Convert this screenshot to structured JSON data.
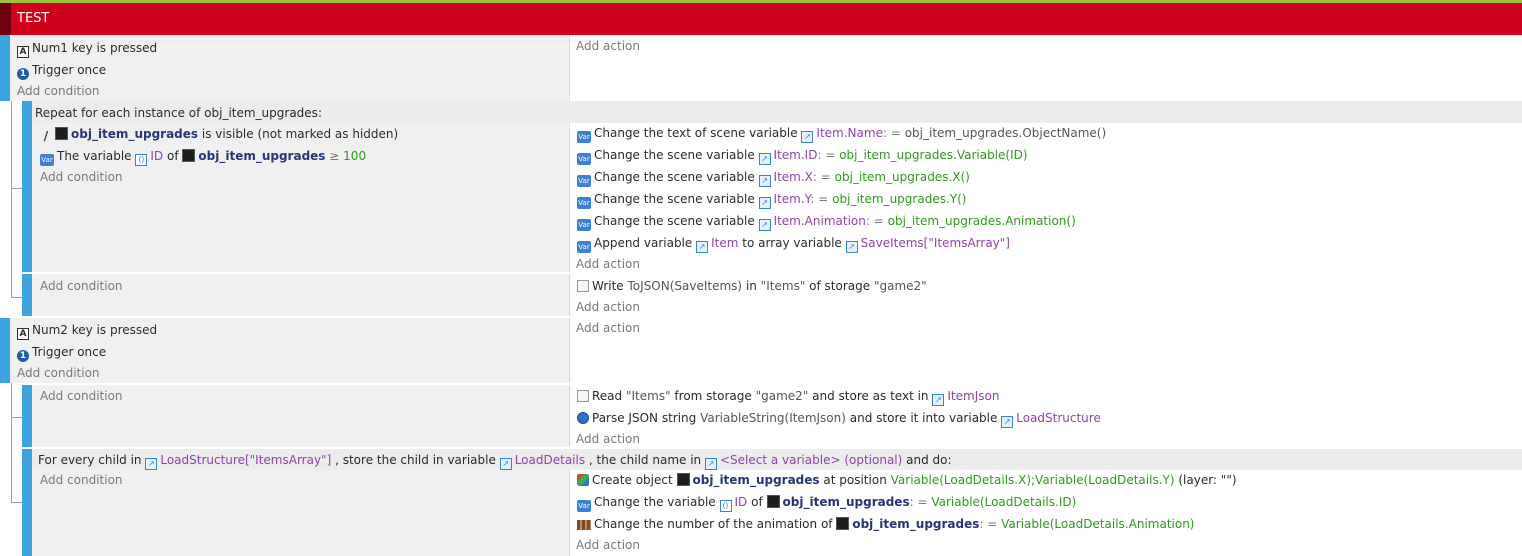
{
  "group": {
    "title": "TEST"
  },
  "add_condition": "Add condition",
  "add_action": "Add action",
  "event1": {
    "cond1": {
      "key": "Num1",
      "text": "key is pressed"
    },
    "cond2": {
      "text": "Trigger once"
    }
  },
  "repeat": {
    "header": "Repeat for each instance of obj_item_upgrades:",
    "cond1": {
      "object": "obj_item_upgrades",
      "text": "is visible (not marked as hidden)"
    },
    "cond2": {
      "prefix": "The variable",
      "var": "ID",
      "of": "of",
      "object": "obj_item_upgrades",
      "op": "≥",
      "value": "100"
    },
    "actions": [
      {
        "prefix": "Change the text of scene variable",
        "var": "Item.Name",
        "op": ": =",
        "expr": "obj_item_upgrades.ObjectName()"
      },
      {
        "prefix": "Change the scene variable",
        "var": "Item.ID",
        "op": ": =",
        "expr": "obj_item_upgrades.Variable(ID)"
      },
      {
        "prefix": "Change the scene variable",
        "var": "Item.X",
        "op": ": =",
        "expr": "obj_item_upgrades.X()"
      },
      {
        "prefix": "Change the scene variable",
        "var": "Item.Y",
        "op": ": =",
        "expr": "obj_item_upgrades.Y()"
      },
      {
        "prefix": "Change the scene variable",
        "var": "Item.Animation",
        "op": ": =",
        "expr": "obj_item_upgrades.Animation()"
      },
      {
        "prefix": "Append variable",
        "var": "Item",
        "mid": "to array variable",
        "var2": "SaveItems[\"ItemsArray\"]"
      }
    ]
  },
  "write": {
    "prefix": "Write",
    "expr": "ToJSON(SaveItems)",
    "in": "in",
    "key": "\"Items\"",
    "of": "of storage",
    "storage": "\"game2\""
  },
  "event2": {
    "cond1": {
      "key": "Num2",
      "text": "key is pressed"
    },
    "cond2": {
      "text": "Trigger once"
    }
  },
  "read": {
    "action1": {
      "prefix": "Read",
      "key": "\"Items\"",
      "mid": "from storage",
      "storage": "\"game2\"",
      "suffix": "and store as text in",
      "var": "ItemJson"
    },
    "action2": {
      "prefix": "Parse JSON string",
      "expr": "VariableString(ItemJson)",
      "mid": "and store it into variable",
      "var": "LoadStructure"
    }
  },
  "foreach": {
    "header": {
      "prefix": "For every child in",
      "var": "LoadStructure[\"ItemsArray\"]",
      "mid": ", store the child in variable",
      "var2": "LoadDetails",
      "mid2": ", the child name in",
      "var3": "<Select a variable> (optional)",
      "suffix": "and do:"
    },
    "action1": {
      "prefix": "Create object",
      "object": "obj_item_upgrades",
      "mid": "at position",
      "expr": "Variable(LoadDetails.X);Variable(LoadDetails.Y)",
      "layer": "(layer: \"\")"
    },
    "action2": {
      "prefix": "Change the variable",
      "var": "ID",
      "of": "of",
      "object": "obj_item_upgrades",
      "op": ": =",
      "expr": "Variable(LoadDetails.ID)"
    },
    "action3": {
      "prefix": "Change the number of the animation of",
      "object": "obj_item_upgrades",
      "op": ": =",
      "expr": "Variable(LoadDetails.Animation)"
    }
  }
}
